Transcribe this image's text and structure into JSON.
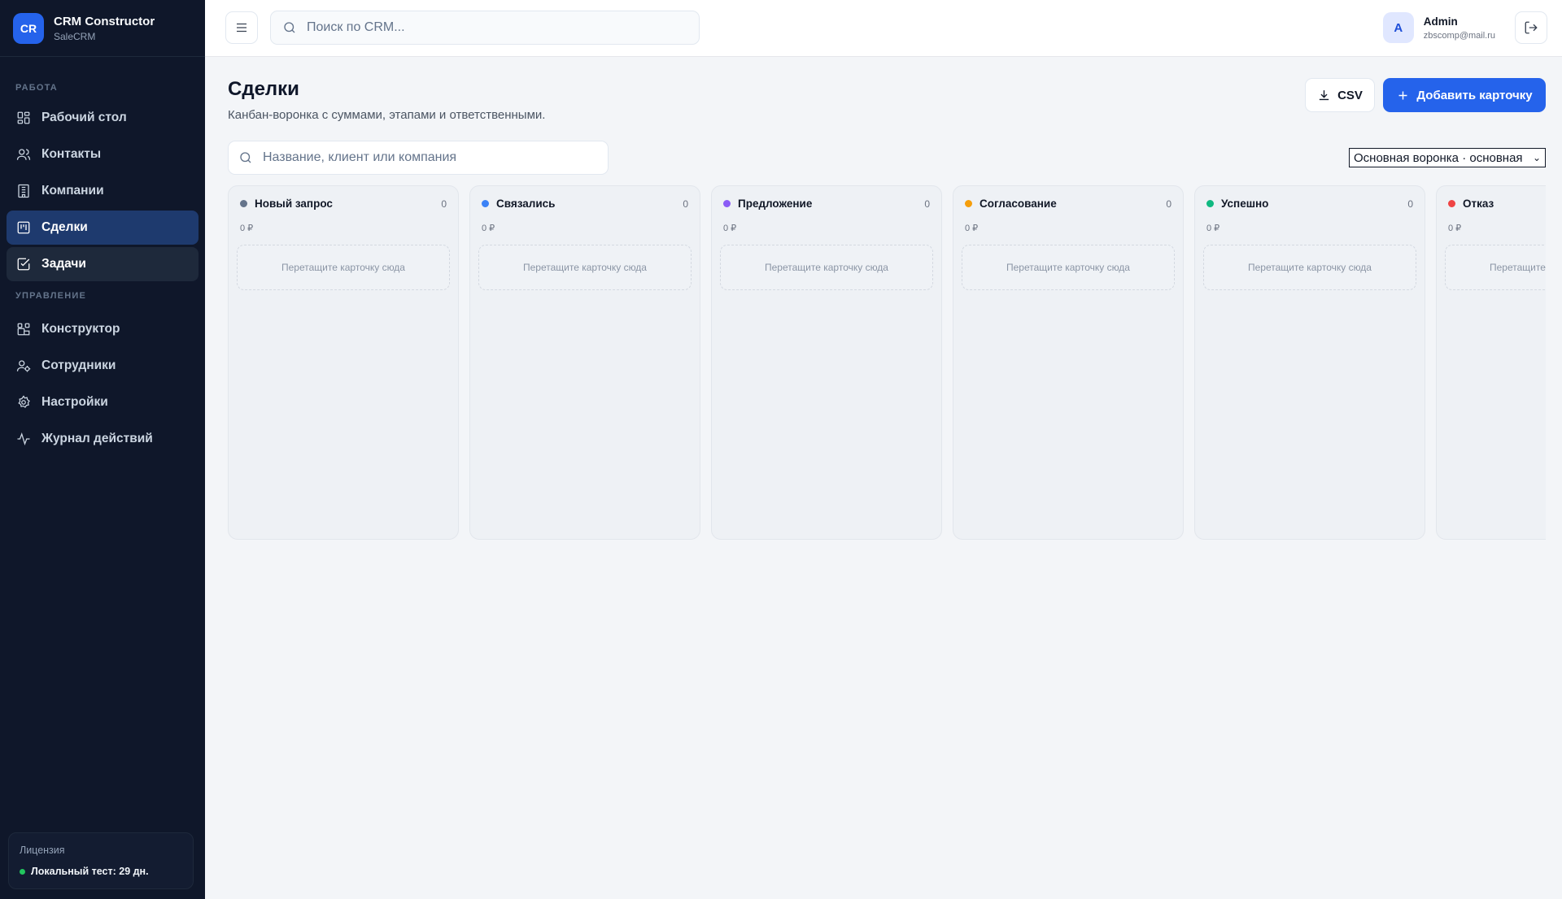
{
  "brand": {
    "logo": "CR",
    "title": "CRM Constructor",
    "subtitle": "SaleCRM"
  },
  "sidebar": {
    "work_label": "РАБОТА",
    "manage_label": "УПРАВЛЕНИЕ",
    "work_items": [
      {
        "label": "Рабочий стол",
        "icon": "dashboard-icon"
      },
      {
        "label": "Контакты",
        "icon": "users-icon"
      },
      {
        "label": "Компании",
        "icon": "building-icon"
      },
      {
        "label": "Сделки",
        "icon": "kanban-icon",
        "active": true
      },
      {
        "label": "Задачи",
        "icon": "checkbox-icon"
      }
    ],
    "manage_items": [
      {
        "label": "Конструктор",
        "icon": "blocks-icon"
      },
      {
        "label": "Сотрудники",
        "icon": "user-gear-icon"
      },
      {
        "label": "Настройки",
        "icon": "gear-icon"
      },
      {
        "label": "Журнал действий",
        "icon": "activity-icon"
      }
    ],
    "license": {
      "title": "Лицензия",
      "status": "Локальный тест: 29 дн.",
      "status_color": "#22c55e"
    }
  },
  "topbar": {
    "search_placeholder": "Поиск по CRM...",
    "user": {
      "initial": "A",
      "name": "Admin",
      "email": "zbscomp@mail.ru"
    }
  },
  "page": {
    "title": "Сделки",
    "subtitle": "Канбан-воронка с суммами, этапами и ответственными.",
    "csv_label": "CSV",
    "add_label": "Добавить карточку",
    "search_placeholder": "Название, клиент или компания",
    "funnel_selected": "Основная воронка · основная",
    "accent": "#2563eb"
  },
  "board": {
    "dropzone_text": "Перетащите карточку сюда",
    "columns": [
      {
        "name": "Новый запрос",
        "count": "0",
        "sum": "0 ₽",
        "color": "#64748b"
      },
      {
        "name": "Связались",
        "count": "0",
        "sum": "0 ₽",
        "color": "#3b82f6"
      },
      {
        "name": "Предложение",
        "count": "0",
        "sum": "0 ₽",
        "color": "#8b5cf6"
      },
      {
        "name": "Согласование",
        "count": "0",
        "sum": "0 ₽",
        "color": "#f59e0b"
      },
      {
        "name": "Успешно",
        "count": "0",
        "sum": "0 ₽",
        "color": "#10b981"
      },
      {
        "name": "Отказ",
        "count": "0",
        "sum": "0 ₽",
        "color": "#ef4444"
      }
    ]
  }
}
